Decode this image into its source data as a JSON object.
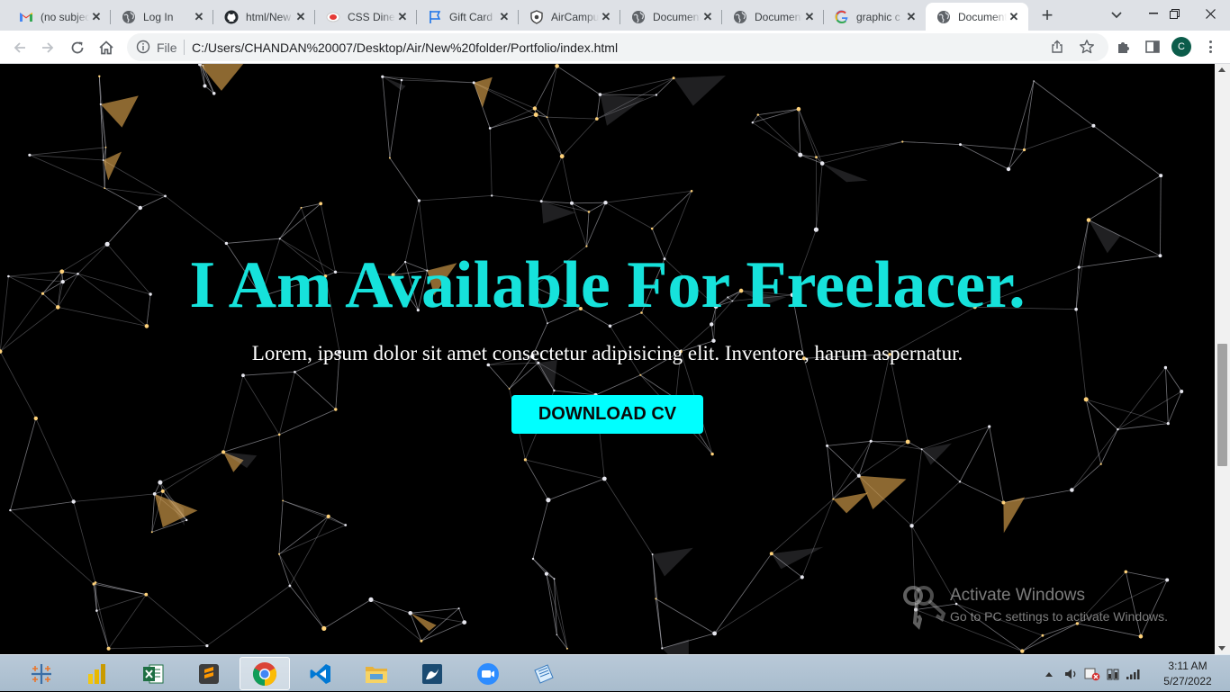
{
  "browser": {
    "tabs": [
      {
        "title": "(no subject)",
        "icon": "gmail-icon",
        "active": false
      },
      {
        "title": "Log In",
        "icon": "globe-icon",
        "active": false
      },
      {
        "title": "html/New",
        "icon": "github-icon",
        "active": false
      },
      {
        "title": "CSS Diner",
        "icon": "css-diner-icon",
        "active": false
      },
      {
        "title": "Gift Card",
        "icon": "flag-icon",
        "active": false
      },
      {
        "title": "AirCampus",
        "icon": "aircampus-icon",
        "active": false
      },
      {
        "title": "Document",
        "icon": "globe-icon",
        "active": false
      },
      {
        "title": "Document",
        "icon": "globe-icon",
        "active": false
      },
      {
        "title": "graphic c",
        "icon": "google-icon",
        "active": false
      },
      {
        "title": "Document",
        "icon": "globe-icon",
        "active": true
      }
    ],
    "address": {
      "scheme_label": "File",
      "url": "C:/Users/CHANDAN%20007/Desktop/Air/New%20folder/Portfolio/index.html"
    },
    "profile_initial": "C"
  },
  "page": {
    "hero_title": "I Am Available For Freelacer.",
    "hero_subtitle": "Lorem, ipsum dolor sit amet consectetur adipisicing elit. Inventore, harum aspernatur.",
    "cta_label": "DOWNLOAD CV",
    "colors": {
      "title": "#16e2db",
      "button": "#00ffff",
      "background": "#000000"
    }
  },
  "watermark": {
    "title": "Activate Windows",
    "subtitle": "Go to PC settings to activate Windows."
  },
  "taskbar": {
    "apps": [
      "tableau-icon",
      "power-bi-icon",
      "excel-icon",
      "sublime-text-icon",
      "chrome-icon",
      "vscode-icon",
      "file-explorer-icon",
      "mysql-workbench-icon",
      "zoom-icon",
      "notepad-icon"
    ],
    "time": "3:11 AM",
    "date": "5/27/2022"
  }
}
